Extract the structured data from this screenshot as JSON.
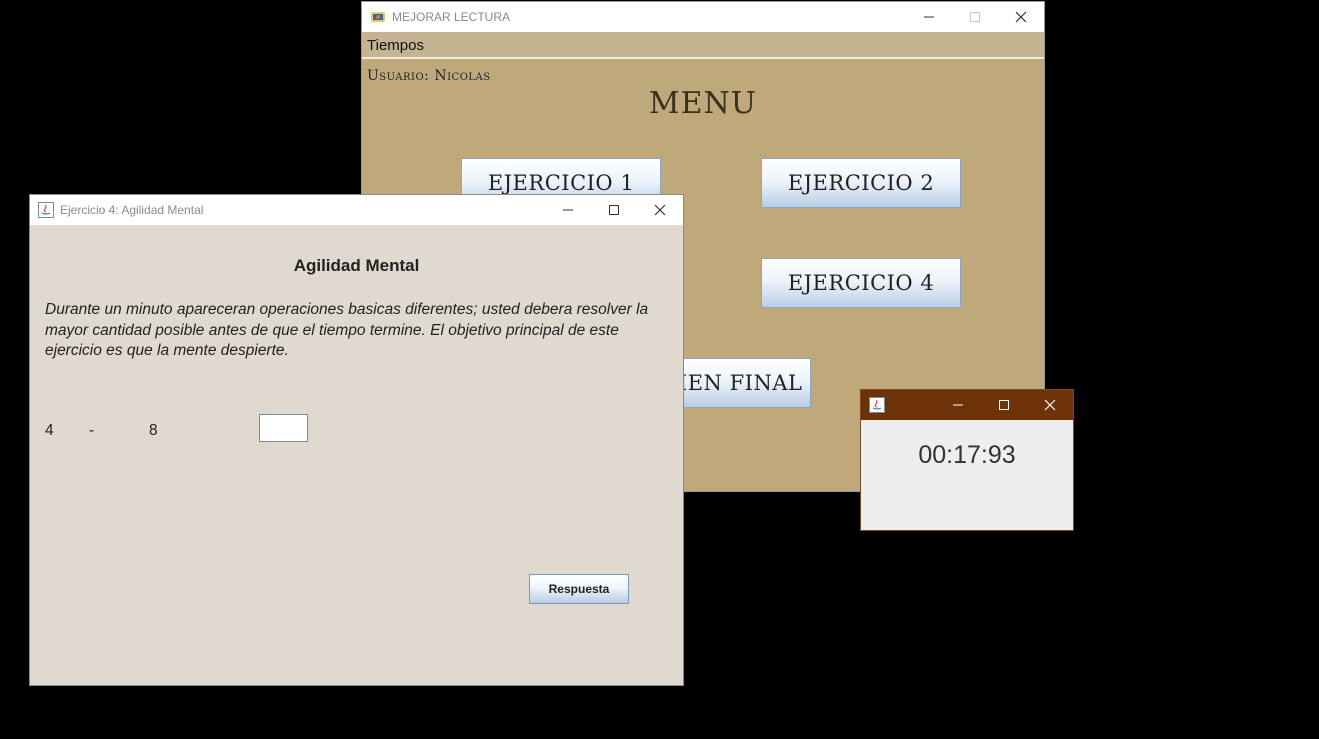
{
  "main_window": {
    "title": "MEJORAR LECTURA",
    "menu": [
      "Tiempos"
    ],
    "user_label": "Usuario: Nicolas",
    "heading": "MENU",
    "buttons": {
      "ex1": "EJERCICIO 1",
      "ex2": "EJERCICIO 2",
      "ex4": "EJERCICIO 4",
      "final": "EXAMEN FINAL"
    }
  },
  "exercise_window": {
    "title": "Ejercicio 4: Agilidad Mental",
    "heading": "Agilidad Mental",
    "description": "Durante un minuto apareceran operaciones basicas diferentes; usted debera resolver la mayor cantidad posible antes de que el tiempo termine. El objetivo principal de este ejercicio es que la mente despierte.",
    "operand_a": "4",
    "operator": "-",
    "operand_b": "8",
    "answer_value": "",
    "submit_label": "Respuesta"
  },
  "timer_window": {
    "display": "00:17:93"
  },
  "colors": {
    "main_bg": "#bfa97b",
    "exercise_bg": "#e0d9cf",
    "timer_titlebar": "#6e3208"
  }
}
